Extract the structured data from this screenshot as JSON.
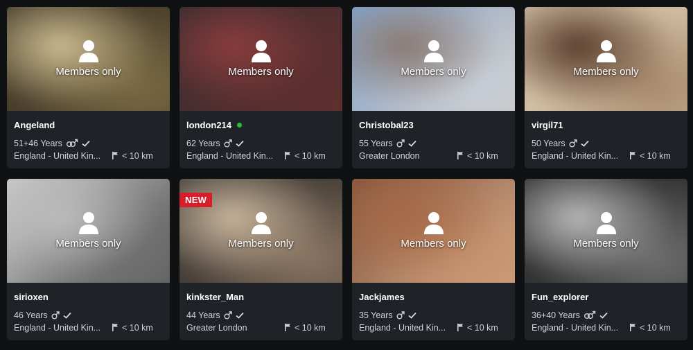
{
  "members_only_label": "Members only",
  "new_badge_label": "NEW",
  "colors": {
    "online": "#2bbf3a",
    "new_badge": "#d61f2b",
    "card_bg": "#1f2328"
  },
  "profiles": [
    {
      "name": "Angeland",
      "age": "51+46 Years",
      "gender": "couple",
      "verified": true,
      "online": false,
      "is_new": false,
      "location": "England - United Kin...",
      "distance": "< 10 km",
      "photo_colors": [
        "#3a3526",
        "#7a6a44",
        "#cdbb8f",
        "#5a4a33"
      ]
    },
    {
      "name": "london214",
      "age": "62 Years",
      "gender": "male",
      "verified": true,
      "online": true,
      "is_new": false,
      "location": "England - United Kin...",
      "distance": "< 10 km",
      "photo_colors": [
        "#2a2a2e",
        "#5a2e2e",
        "#8a3c3c",
        "#6b3232"
      ]
    },
    {
      "name": "Christobal23",
      "age": "55 Years",
      "gender": "male",
      "verified": true,
      "online": false,
      "is_new": false,
      "location": "Greater London",
      "distance": "< 10 km",
      "photo_colors": [
        "#7aa4d6",
        "#c8cfd8",
        "#8a7a72",
        "#d8c8bb"
      ]
    },
    {
      "name": "virgil71",
      "age": "50 Years",
      "gender": "male",
      "verified": true,
      "online": false,
      "is_new": false,
      "location": "England - United Kin...",
      "distance": "< 10 km",
      "photo_colors": [
        "#d9c7ae",
        "#a88a6e",
        "#5a3e2c",
        "#c9b49a"
      ]
    },
    {
      "name": "sirioxen",
      "age": "46 Years",
      "gender": "male",
      "verified": true,
      "online": false,
      "is_new": false,
      "location": "England - United Kin...",
      "distance": "< 10 km",
      "photo_colors": [
        "#d8d8d8",
        "#6e6e6e",
        "#bcbcbc",
        "#4a4a4a"
      ]
    },
    {
      "name": "kinkster_Man",
      "age": "44 Years",
      "gender": "male",
      "verified": true,
      "online": false,
      "is_new": true,
      "location": "Greater London",
      "distance": "< 10 km",
      "photo_colors": [
        "#3d3a36",
        "#8a7562",
        "#c9b59c",
        "#55483d"
      ]
    },
    {
      "name": "Jackjames",
      "age": "35 Years",
      "gender": "male",
      "verified": true,
      "online": false,
      "is_new": false,
      "location": "England - United Kin...",
      "distance": "< 10 km",
      "photo_colors": [
        "#7a4a32",
        "#c8936e",
        "#a66a48",
        "#d9b090"
      ]
    },
    {
      "name": "Fun_explorer",
      "age": "36+40 Years",
      "gender": "couple",
      "verified": true,
      "online": false,
      "is_new": false,
      "location": "England - United Kin...",
      "distance": "< 10 km",
      "photo_colors": [
        "#2a2a2a",
        "#6e6e6e",
        "#b8b8b8",
        "#404040"
      ]
    }
  ]
}
